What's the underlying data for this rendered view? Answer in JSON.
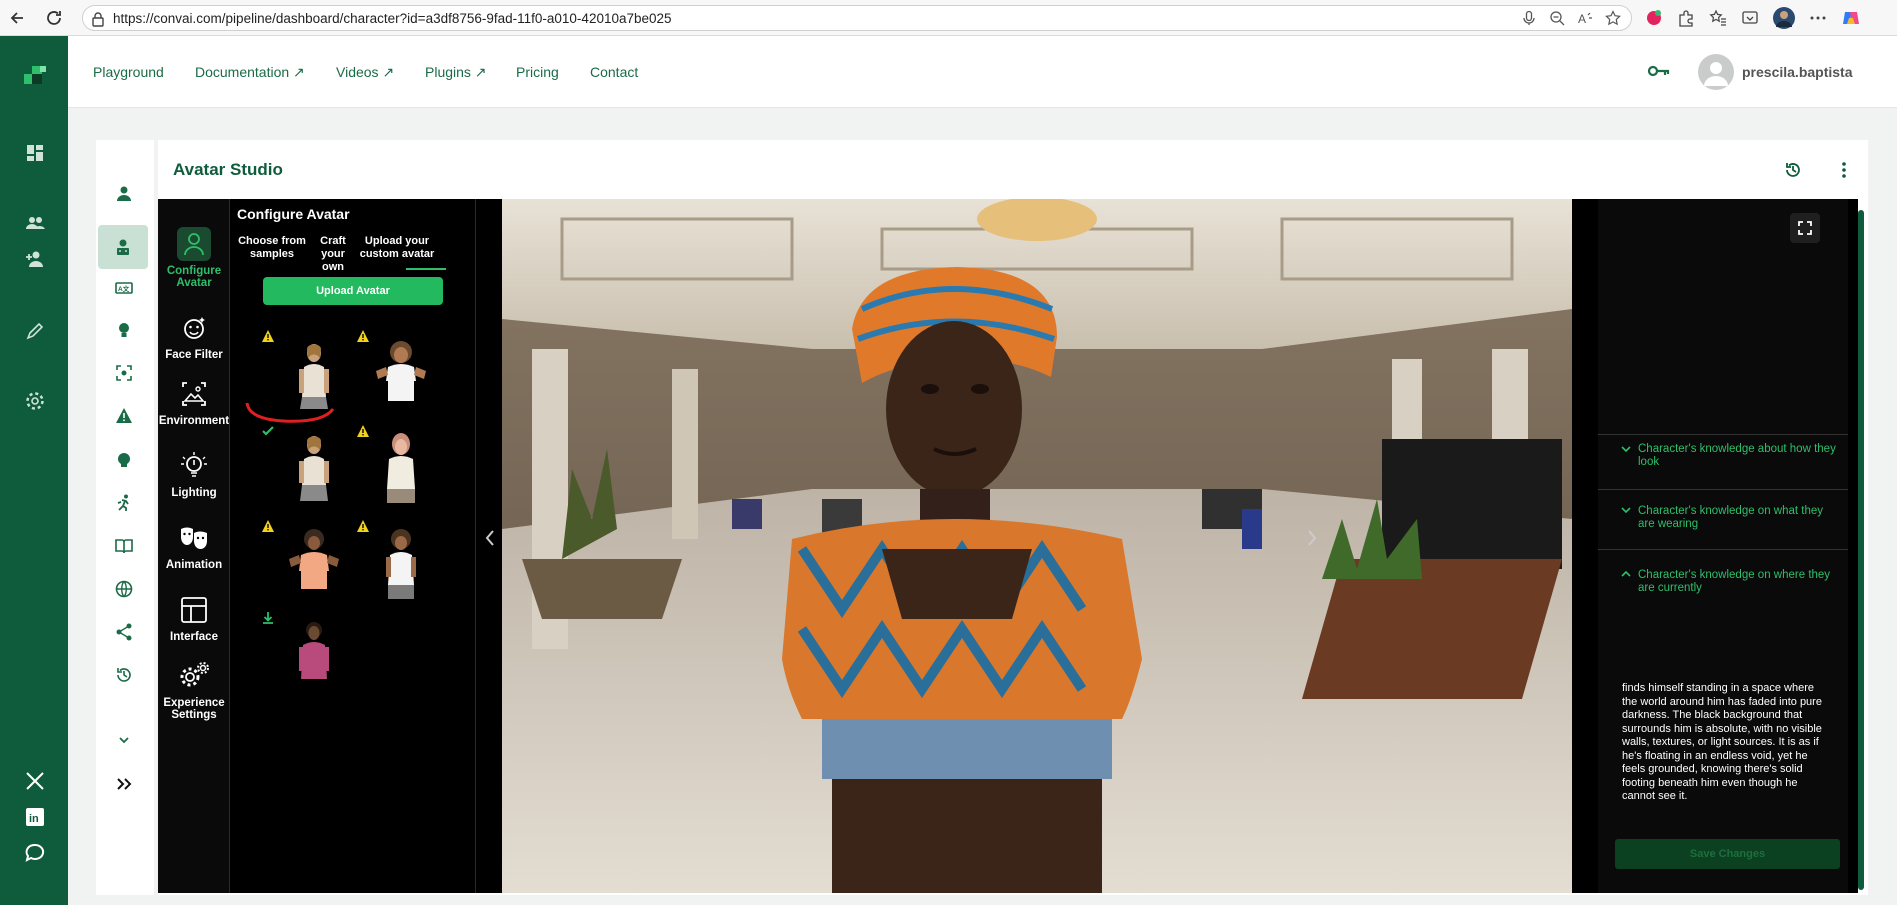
{
  "browser": {
    "url": "https://convai.com/pipeline/dashboard/character?id=a3df8756-9fad-11f0-a010-42010a7be025"
  },
  "topnav": {
    "links": [
      {
        "label": "Playground"
      },
      {
        "label": "Documentation ↗"
      },
      {
        "label": "Videos ↗"
      },
      {
        "label": "Plugins ↗"
      },
      {
        "label": "Pricing"
      },
      {
        "label": "Contact"
      }
    ],
    "username": "prescila.baptista"
  },
  "studio": {
    "title": "Avatar Studio"
  },
  "tools": [
    {
      "label": "Configure Avatar",
      "icon": "person-icon"
    },
    {
      "label": "Face Filter",
      "icon": "face-filter-icon"
    },
    {
      "label": "Environment",
      "icon": "environment-icon"
    },
    {
      "label": "Lighting",
      "icon": "bulb-icon"
    },
    {
      "label": "Animation",
      "icon": "masks-icon"
    },
    {
      "label": "Interface",
      "icon": "layout-icon"
    },
    {
      "label": "Experience Settings",
      "icon": "gears-icon"
    }
  ],
  "config": {
    "title": "Configure Avatar",
    "tabs": [
      {
        "label": "Choose from samples"
      },
      {
        "label": "Craft your own"
      },
      {
        "label": "Upload your custom avatar"
      }
    ],
    "upload_label": "Upload Avatar",
    "accent": "#22b95f"
  },
  "knowledge": {
    "items": [
      {
        "label": "Character's knowledge about how they look"
      },
      {
        "label": "Character's knowledge on what they are wearing"
      },
      {
        "label": "Character's knowledge on where they are currently"
      }
    ],
    "expanded_text": "finds himself standing in a space where the world around him has faded into pure darkness. The black background that surrounds him is absolute, with no visible walls, textures, or light sources. It is as if he's floating in an endless void, yet he feels grounded, knowing there's solid footing beneath him even though he cannot see it.",
    "save_label": "Save Changes"
  },
  "colors": {
    "brand_green": "#0f5c3d",
    "accent_green": "#2fbf6a"
  }
}
